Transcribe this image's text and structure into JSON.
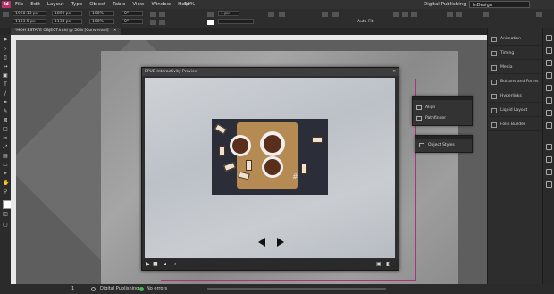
{
  "app": {
    "logo": "Id",
    "menu": [
      "File",
      "Edit",
      "Layout",
      "Type",
      "Object",
      "Table",
      "View",
      "Window",
      "Help"
    ],
    "zoom": "50%",
    "workspace": "Digital Publishing",
    "search_placeholder": "InDesign",
    "window_buttons": [
      "–",
      "□",
      "✕"
    ]
  },
  "controls": {
    "x": "1968.13 px",
    "y": "1133.5 px",
    "w": "1890 px",
    "h": "1134 px",
    "zoom_pct": "100%",
    "zoom_pct2": "100%",
    "angle": "0°",
    "shear": "0°",
    "stroke": "1 px",
    "autofit": "Auto-Fit"
  },
  "document": {
    "tab": "*MOH ESTATE OBJECT.indd @ 50% [Converted]",
    "tab_close": "✕"
  },
  "preview": {
    "title": "EPUB Interactivity Preview",
    "close": "✕"
  },
  "float_panel_1": {
    "items": [
      {
        "label": "Align",
        "icon": "align-icon"
      },
      {
        "label": "Pathfinder",
        "icon": "pathfinder-icon"
      }
    ]
  },
  "float_panel_2": {
    "items": [
      {
        "label": "Object Styles",
        "icon": "object-styles-icon"
      }
    ]
  },
  "panels": [
    {
      "label": "Animation",
      "icon": "animation-icon"
    },
    {
      "label": "Timing",
      "icon": "timing-icon"
    },
    {
      "label": "Media",
      "icon": "media-icon"
    },
    {
      "label": "Buttons and Forms",
      "icon": "buttons-forms-icon"
    },
    {
      "label": "Hyperlinks",
      "icon": "hyperlinks-icon"
    },
    {
      "label": "Liquid Layout",
      "icon": "liquid-layout-icon"
    },
    {
      "label": "Folio Builder",
      "icon": "folio-builder-icon"
    }
  ],
  "status": {
    "page": "1",
    "state": "Digital Publishing",
    "errors": "No errors"
  },
  "colors": {
    "accent": "#b8326a",
    "preflight_ok": "#3fb950",
    "guide": "#b0307a"
  }
}
